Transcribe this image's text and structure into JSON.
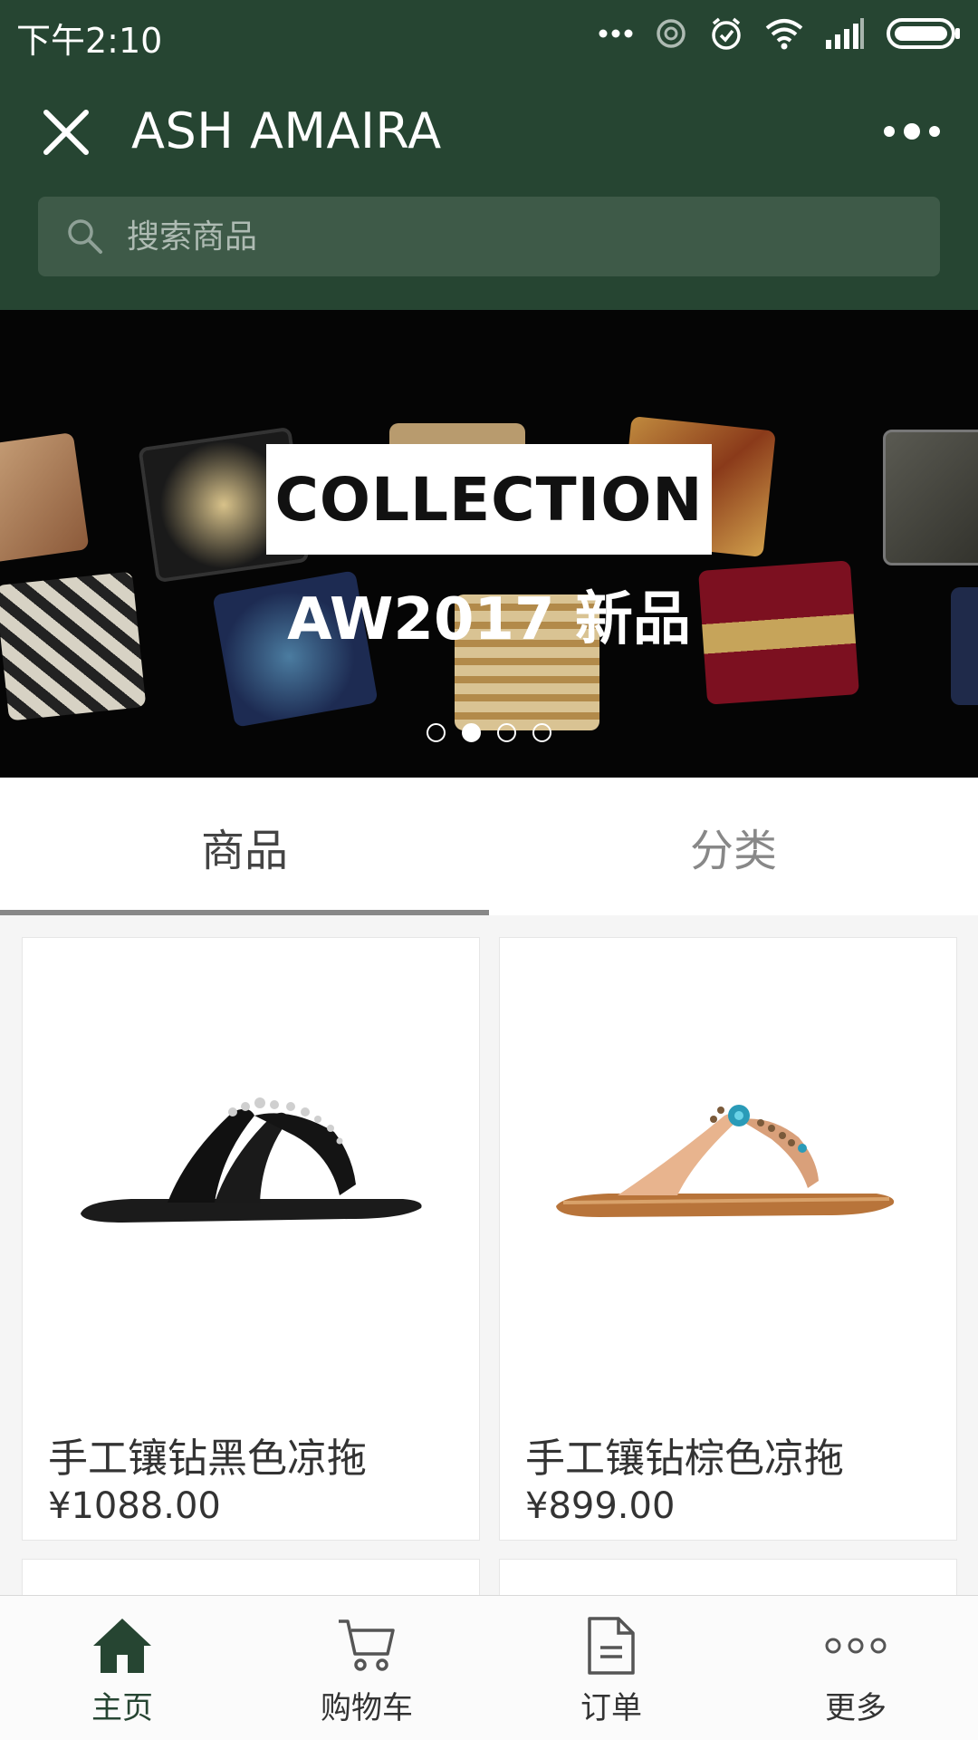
{
  "status_bar": {
    "time": "下午2:10",
    "icons": [
      "more-dots-icon",
      "sync-icon",
      "alarm-icon",
      "wifi-icon",
      "signal-icon",
      "battery-icon"
    ]
  },
  "navbar": {
    "title": "ASH AMAIRA",
    "close_icon": "close-icon",
    "more_icon": "more-dots-icon"
  },
  "search": {
    "placeholder": "搜索商品",
    "icon": "search-icon"
  },
  "banner": {
    "heading": "COLLECTION",
    "subtitle": "AW2017 新品",
    "slide_count": 4,
    "active_slide": 2
  },
  "tabs": [
    {
      "label": "商品",
      "active": true
    },
    {
      "label": "分类",
      "active": false
    }
  ],
  "products": [
    {
      "name": "手工镶钻黑色凉拖",
      "price": "¥1088.00",
      "image": "black-sandal-image"
    },
    {
      "name": "手工镶钻棕色凉拖",
      "price": "¥899.00",
      "image": "brown-sandal-image"
    }
  ],
  "tabbar": [
    {
      "label": "主页",
      "icon": "home-icon",
      "active": true
    },
    {
      "label": "购物车",
      "icon": "cart-icon",
      "active": false
    },
    {
      "label": "订单",
      "icon": "document-icon",
      "active": false
    },
    {
      "label": "更多",
      "icon": "more-circles-icon",
      "active": false
    }
  ],
  "colors": {
    "header_bg": "#264532",
    "search_bg": "#3e5a48",
    "accent": "#264532",
    "tab_indicator": "#888888"
  }
}
